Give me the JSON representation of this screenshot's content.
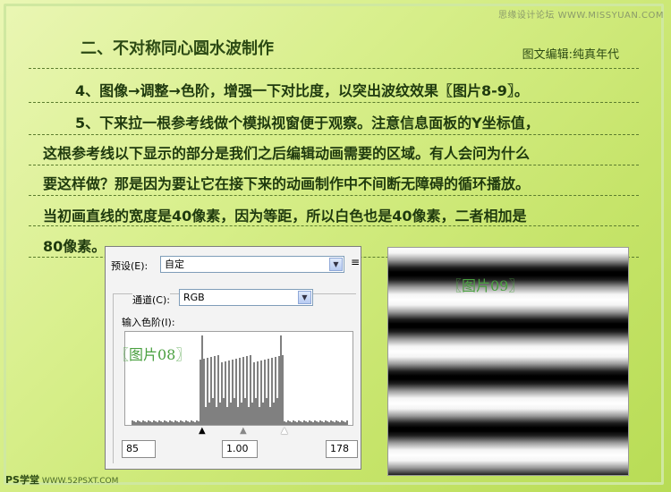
{
  "watermark_top": "思缘设计论坛 WWW.MISSYUAN.COM",
  "heading": "二、不对称同心圆水波制作",
  "editor": "图文编辑:纯真年代",
  "lines": [
    "4、图像→调整→色阶，增强一下对比度，以突出波纹效果〖图片8-9〗。",
    "5、下来拉一根参考线做个模拟视窗便于观察。注意信息面板的Y坐标值，",
    "这根参考线以下显示的部分是我们之后编辑动画需要的区域。有人会问为什么",
    "要这样做？那是因为要让它在接下来的动画制作中不间断无障碍的循环播放。",
    "当初画直线的宽度是40像素，因为等距，所以白色也是40像素，二者相加是",
    "80像素。"
  ],
  "levels_panel": {
    "preset_label": "预设(E):",
    "preset_value": "自定",
    "channel_label": "通道(C):",
    "channel_value": "RGB",
    "input_label": "输入色阶(I):",
    "input_black": "85",
    "input_gamma": "1.00",
    "input_white": "178"
  },
  "captions": {
    "fig08": "〖图片08〗",
    "fig09": "〖图片09〗"
  },
  "bottom_logo": {
    "brand": "PS学堂",
    "url": "WWW.52PSXT.COM"
  },
  "colors": {
    "background": "#d8ef8c",
    "text": "#1f3a0e",
    "caption": "#4aa040"
  }
}
